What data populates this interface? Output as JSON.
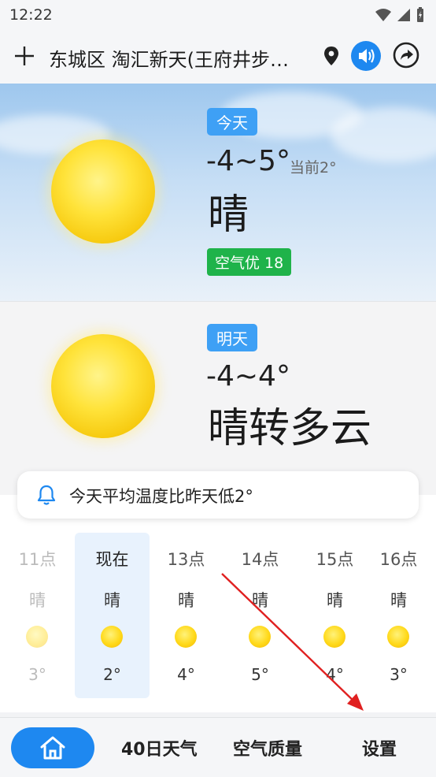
{
  "status": {
    "time": "12:22"
  },
  "header": {
    "city": "东城区 淘汇新天(王府井步…"
  },
  "today": {
    "tag": "今天",
    "temp_range": "-4~5°",
    "current": "当前2°",
    "condition": "晴",
    "aqi": "空气优 18"
  },
  "tomorrow": {
    "tag": "明天",
    "temp_range": "-4~4°",
    "condition": "晴转多云"
  },
  "notice": {
    "text": "今天平均温度比昨天低2°"
  },
  "hourly": [
    {
      "label": "11点",
      "cond": "晴",
      "temp": "3°"
    },
    {
      "label": "现在",
      "cond": "晴",
      "temp": "2°"
    },
    {
      "label": "13点",
      "cond": "晴",
      "temp": "4°"
    },
    {
      "label": "14点",
      "cond": "晴",
      "temp": "5°"
    },
    {
      "label": "15点",
      "cond": "晴",
      "temp": "4°"
    },
    {
      "label": "16点",
      "cond": "晴",
      "temp": "3°"
    }
  ],
  "nav": {
    "forecast40": "40日天气",
    "air": "空气质量",
    "settings": "设置"
  },
  "colors": {
    "accent": "#1e88f0",
    "aqi_good": "#1fb34a",
    "annotation": "#e02020"
  }
}
